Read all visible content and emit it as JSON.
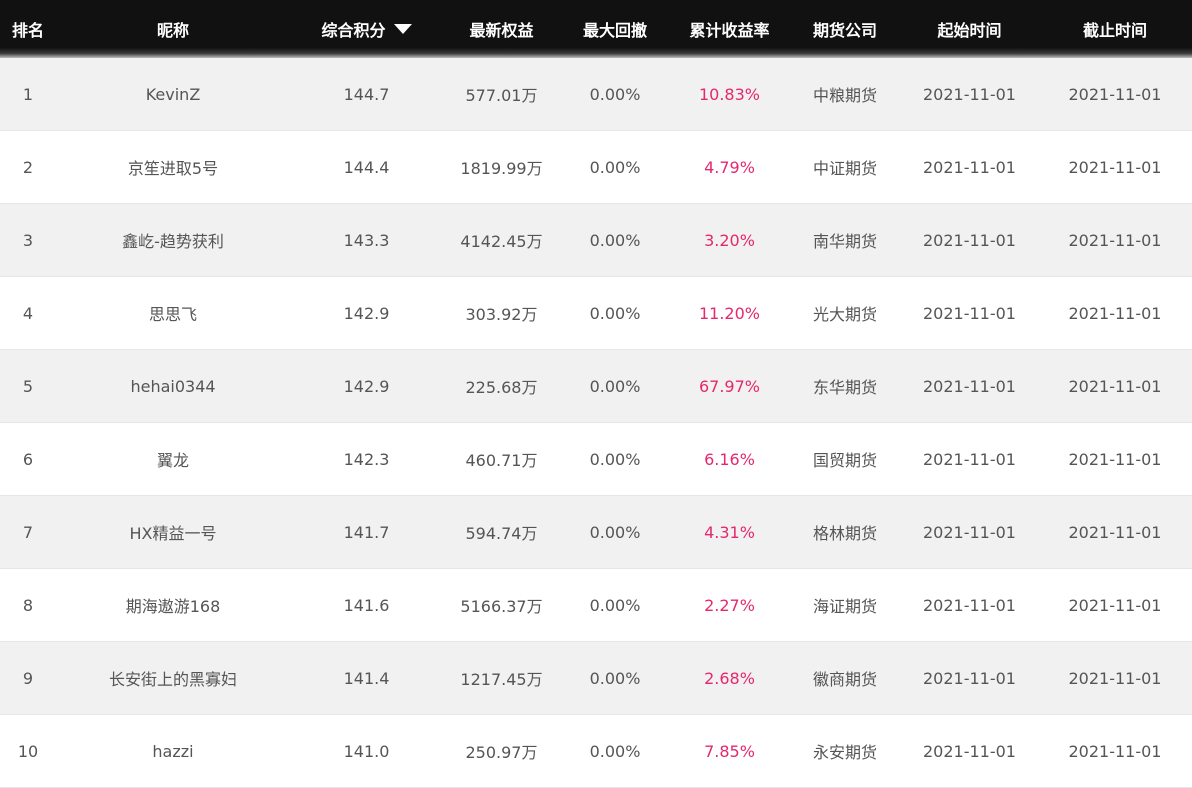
{
  "columns": {
    "rank": "排名",
    "nickname": "昵称",
    "score": "综合积分",
    "equity": "最新权益",
    "max_drawdown": "最大回撤",
    "cumulative_return": "累计收益率",
    "futures_company": "期货公司",
    "start_time": "起始时间",
    "end_time": "截止时间"
  },
  "sort": {
    "column": "score",
    "direction": "desc",
    "icon": "sort-descending-icon"
  },
  "colors": {
    "header_bg": "#111111",
    "header_text": "#ffffff",
    "row_alt_bg": "#f1f1f1",
    "text": "#555555",
    "return_text": "#e5286e"
  },
  "rows": [
    {
      "rank": "1",
      "nickname": "KevinZ",
      "score": "144.7",
      "equity": "577.01万",
      "max_drawdown": "0.00%",
      "cumulative_return": "10.83%",
      "futures_company": "中粮期货",
      "start_time": "2021-11-01",
      "end_time": "2021-11-01"
    },
    {
      "rank": "2",
      "nickname": "京笙进取5号",
      "score": "144.4",
      "equity": "1819.99万",
      "max_drawdown": "0.00%",
      "cumulative_return": "4.79%",
      "futures_company": "中证期货",
      "start_time": "2021-11-01",
      "end_time": "2021-11-01"
    },
    {
      "rank": "3",
      "nickname": "鑫屹-趋势获利",
      "score": "143.3",
      "equity": "4142.45万",
      "max_drawdown": "0.00%",
      "cumulative_return": "3.20%",
      "futures_company": "南华期货",
      "start_time": "2021-11-01",
      "end_time": "2021-11-01"
    },
    {
      "rank": "4",
      "nickname": "思思飞",
      "score": "142.9",
      "equity": "303.92万",
      "max_drawdown": "0.00%",
      "cumulative_return": "11.20%",
      "futures_company": "光大期货",
      "start_time": "2021-11-01",
      "end_time": "2021-11-01"
    },
    {
      "rank": "5",
      "nickname": "hehai0344",
      "score": "142.9",
      "equity": "225.68万",
      "max_drawdown": "0.00%",
      "cumulative_return": "67.97%",
      "futures_company": "东华期货",
      "start_time": "2021-11-01",
      "end_time": "2021-11-01"
    },
    {
      "rank": "6",
      "nickname": "翼龙",
      "score": "142.3",
      "equity": "460.71万",
      "max_drawdown": "0.00%",
      "cumulative_return": "6.16%",
      "futures_company": "国贸期货",
      "start_time": "2021-11-01",
      "end_time": "2021-11-01"
    },
    {
      "rank": "7",
      "nickname": "HX精益一号",
      "score": "141.7",
      "equity": "594.74万",
      "max_drawdown": "0.00%",
      "cumulative_return": "4.31%",
      "futures_company": "格林期货",
      "start_time": "2021-11-01",
      "end_time": "2021-11-01"
    },
    {
      "rank": "8",
      "nickname": "期海遨游168",
      "score": "141.6",
      "equity": "5166.37万",
      "max_drawdown": "0.00%",
      "cumulative_return": "2.27%",
      "futures_company": "海证期货",
      "start_time": "2021-11-01",
      "end_time": "2021-11-01"
    },
    {
      "rank": "9",
      "nickname": "长安街上的黑寡妇",
      "score": "141.4",
      "equity": "1217.45万",
      "max_drawdown": "0.00%",
      "cumulative_return": "2.68%",
      "futures_company": "徽商期货",
      "start_time": "2021-11-01",
      "end_time": "2021-11-01"
    },
    {
      "rank": "10",
      "nickname": "hazzi",
      "score": "141.0",
      "equity": "250.97万",
      "max_drawdown": "0.00%",
      "cumulative_return": "7.85%",
      "futures_company": "永安期货",
      "start_time": "2021-11-01",
      "end_time": "2021-11-01"
    }
  ]
}
